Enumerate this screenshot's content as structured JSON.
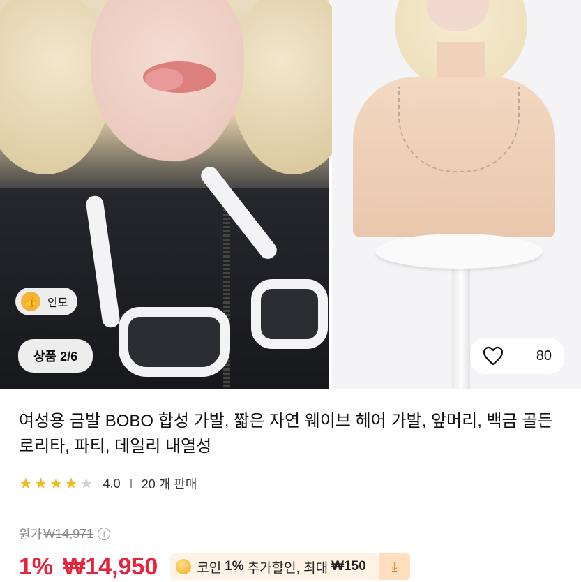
{
  "gallery": {
    "seller_badge": "인모",
    "image_counter": "상품 2/6",
    "like_count": "80"
  },
  "product": {
    "title": "여성용 금발 BOBO 합성 가발, 짧은 자연 웨이브 헤어 가발, 앞머리, 백금 골든 로리타, 파티, 데일리 내열성",
    "rating": "4.0",
    "stars_filled": 4,
    "stars_total": 5,
    "sold": "20 개 판매"
  },
  "pricing": {
    "original_label": "원가",
    "original_price": "₩14,971",
    "discount": "1%",
    "price": "₩14,950",
    "coin_prefix": "코인",
    "coin_percent": "1%",
    "coin_middle": "추가할인, 최대",
    "coin_max": "₩150"
  },
  "colors": {
    "price_red": "#e8233c",
    "star_gold": "#f2b81e",
    "coin_bg": "#fff3e6"
  }
}
